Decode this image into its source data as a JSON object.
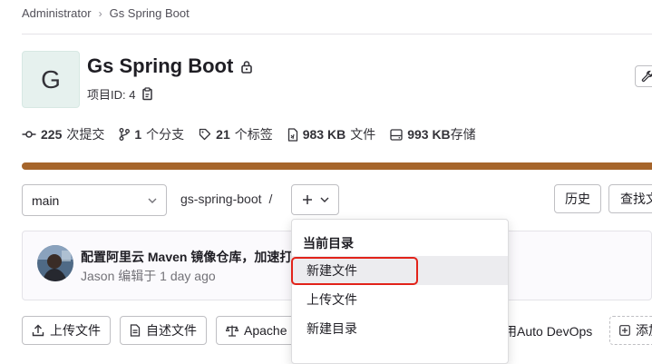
{
  "breadcrumb": {
    "items": [
      "Administrator",
      "Gs Spring Boot"
    ],
    "separator": "›"
  },
  "project": {
    "avatar_letter": "G",
    "name": "Gs Spring Boot",
    "id_label": "项目ID: 4"
  },
  "stats": {
    "commits": {
      "count": "225",
      "label": "次提交"
    },
    "branches": {
      "count": "1",
      "label": "个分支"
    },
    "tags": {
      "count": "21",
      "label": "个标签"
    },
    "files": {
      "count": "983 KB",
      "label": "文件"
    },
    "storage": {
      "count": "993 KB",
      "label": "存储"
    }
  },
  "language_bar_color": "#a6652b",
  "repo": {
    "branch": "main",
    "path": "gs-spring-boot",
    "path_sep": "/",
    "history_label": "历史",
    "find_label": "查找文件"
  },
  "commit": {
    "message": "配置阿里云 Maven 镜像仓库，加速打",
    "author": "Jason",
    "meta": "编辑于 1 day ago"
  },
  "actions": {
    "upload": "上传文件",
    "readme": "自述文件",
    "license": "Apache L",
    "auto_devops": "用Auto DevOps",
    "add": "添加"
  },
  "dropdown": {
    "header": "当前目录",
    "items": [
      "新建文件",
      "上传文件",
      "新建目录"
    ]
  },
  "highlight_color": "#e2231a"
}
